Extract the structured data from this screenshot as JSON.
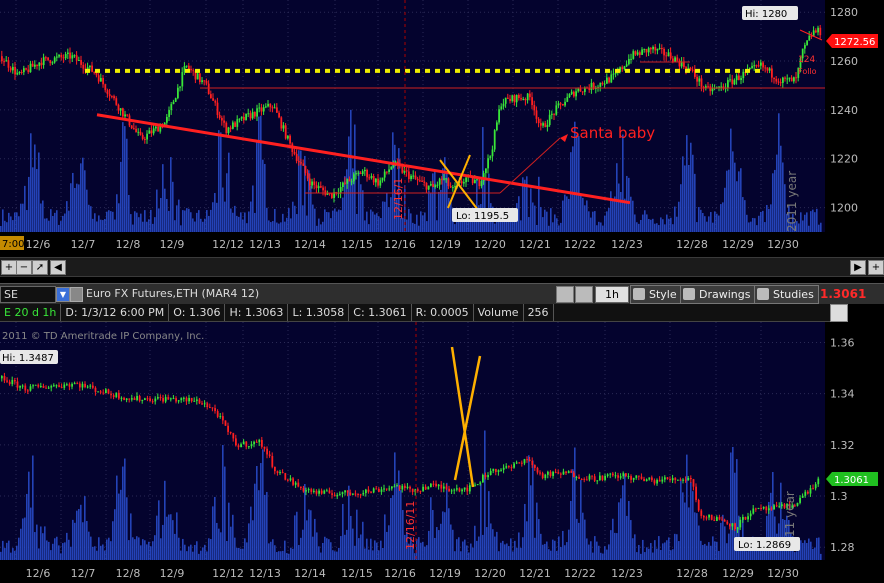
{
  "top_chart": {
    "price_ticks": [
      "1280",
      "1260",
      "1240",
      "1220",
      "1200"
    ],
    "date_labels": [
      "12/6",
      "12/7",
      "12/8",
      "12/9",
      "12/12",
      "12/13",
      "12/14",
      "12/15",
      "12/16",
      "12/19",
      "12/20",
      "12/21",
      "12/22",
      "12/23",
      "12/28",
      "12/29",
      "12/30"
    ],
    "left_stub": "7:00",
    "hi_label": "Hi: 1280",
    "lo_label": "Lo: 1195.5",
    "last_price": "1272.56",
    "annotation": "Santa baby",
    "vertical_date_text": "12/16/1",
    "watermark": "2011 year",
    "fragment_1": "124",
    "fragment_2": "Follo",
    "colors": {
      "up": "#39e639",
      "down": "#ff2020",
      "volume": "#2a4fd0",
      "trend": "#ff2020",
      "support": "#f0f000"
    }
  },
  "chart_data": [
    {
      "type": "candlestick",
      "panel": "top",
      "y_range": [
        1190,
        1285
      ],
      "x_categories": [
        "12/6",
        "12/7",
        "12/8",
        "12/9",
        "12/12",
        "12/13",
        "12/14",
        "12/15",
        "12/16",
        "12/19",
        "12/20",
        "12/21",
        "12/22",
        "12/23",
        "12/28",
        "12/29",
        "12/30"
      ],
      "close_path": [
        [
          0,
          1262
        ],
        [
          18,
          1254
        ],
        [
          40,
          1260
        ],
        [
          70,
          1262
        ],
        [
          95,
          1255
        ],
        [
          120,
          1240
        ],
        [
          140,
          1228
        ],
        [
          165,
          1235
        ],
        [
          185,
          1258
        ],
        [
          205,
          1250
        ],
        [
          225,
          1232
        ],
        [
          250,
          1238
        ],
        [
          272,
          1242
        ],
        [
          290,
          1225
        ],
        [
          310,
          1210
        ],
        [
          330,
          1205
        ],
        [
          345,
          1210
        ],
        [
          362,
          1215
        ],
        [
          378,
          1210
        ],
        [
          392,
          1218
        ],
        [
          405,
          1214
        ],
        [
          420,
          1210
        ],
        [
          432,
          1208
        ],
        [
          442,
          1212
        ],
        [
          452,
          1207
        ],
        [
          465,
          1212
        ],
        [
          478,
          1210
        ],
        [
          490,
          1222
        ],
        [
          500,
          1243
        ],
        [
          515,
          1245
        ],
        [
          530,
          1245
        ],
        [
          540,
          1232
        ],
        [
          555,
          1240
        ],
        [
          575,
          1248
        ],
        [
          595,
          1250
        ],
        [
          615,
          1254
        ],
        [
          630,
          1262
        ],
        [
          650,
          1265
        ],
        [
          670,
          1262
        ],
        [
          690,
          1256
        ],
        [
          705,
          1248
        ],
        [
          720,
          1249
        ],
        [
          740,
          1254
        ],
        [
          760,
          1258
        ],
        [
          780,
          1252
        ],
        [
          795,
          1252
        ],
        [
          802,
          1264
        ],
        [
          812,
          1272
        ],
        [
          820,
          1272
        ]
      ],
      "support_level": 1256,
      "trend_line": [
        [
          97,
          1238
        ],
        [
          630,
          1202
        ]
      ],
      "hi": 1280,
      "lo": 1195.5,
      "last": 1272.56
    },
    {
      "type": "candlestick",
      "panel": "bottom",
      "y_range": [
        1.275,
        1.368
      ],
      "x_categories": [
        "12/6",
        "12/7",
        "12/8",
        "12/9",
        "12/12",
        "12/13",
        "12/14",
        "12/15",
        "12/16",
        "12/19",
        "12/20",
        "12/21",
        "12/22",
        "12/23",
        "12/28",
        "12/29",
        "12/30"
      ],
      "close_path": [
        [
          0,
          1.346
        ],
        [
          25,
          1.342
        ],
        [
          50,
          1.343
        ],
        [
          75,
          1.344
        ],
        [
          100,
          1.341
        ],
        [
          130,
          1.338
        ],
        [
          165,
          1.338
        ],
        [
          200,
          1.337
        ],
        [
          215,
          1.333
        ],
        [
          235,
          1.32
        ],
        [
          260,
          1.321
        ],
        [
          275,
          1.31
        ],
        [
          300,
          1.303
        ],
        [
          320,
          1.301
        ],
        [
          345,
          1.301
        ],
        [
          370,
          1.302
        ],
        [
          395,
          1.304
        ],
        [
          410,
          1.302
        ],
        [
          430,
          1.304
        ],
        [
          450,
          1.303
        ],
        [
          470,
          1.303
        ],
        [
          490,
          1.31
        ],
        [
          510,
          1.311
        ],
        [
          525,
          1.315
        ],
        [
          540,
          1.308
        ],
        [
          565,
          1.309
        ],
        [
          590,
          1.307
        ],
        [
          620,
          1.308
        ],
        [
          650,
          1.306
        ],
        [
          690,
          1.307
        ],
        [
          700,
          1.292
        ],
        [
          720,
          1.291
        ],
        [
          735,
          1.288
        ],
        [
          750,
          1.294
        ],
        [
          770,
          1.295
        ],
        [
          790,
          1.296
        ],
        [
          805,
          1.301
        ],
        [
          818,
          1.306
        ]
      ],
      "hi": 1.3487,
      "lo": 1.2869,
      "last": 1.3061
    }
  ],
  "toolbar": {
    "symbol_stub": "SE",
    "instrument": "Euro FX Futures,ETH (MAR4 12)",
    "timeframe": "1h",
    "style_label": "Style",
    "drawings_label": "Drawings",
    "studies_label": "Studies",
    "last_price": "1.3061"
  },
  "infobar": {
    "stub": "E 20 d 1h",
    "date": "D: 1/3/12 6:00 PM",
    "open": "O: 1.306",
    "high": "H: 1.3063",
    "low": "L: 1.3058",
    "close": "C: 1.3061",
    "range": "R: 0.0005",
    "volume_label": "Volume",
    "volume_value": "256"
  },
  "bottom_chart": {
    "copyright": "2011 © TD Ameritrade IP Company, Inc.",
    "price_ticks": [
      "1.36",
      "1.34",
      "1.32",
      "1.3",
      "1.28"
    ],
    "date_labels": [
      "12/6",
      "12/7",
      "12/8",
      "12/9",
      "12/12",
      "12/13",
      "12/14",
      "12/15",
      "12/16",
      "12/19",
      "12/20",
      "12/21",
      "12/22",
      "12/23",
      "12/28",
      "12/29",
      "12/30"
    ],
    "hi_label": "Hi: 1.3487",
    "lo_label": "Lo: 1.2869",
    "last_price": "1.3061",
    "vertical_date_text": "12/16/11",
    "watermark": "11 year"
  }
}
